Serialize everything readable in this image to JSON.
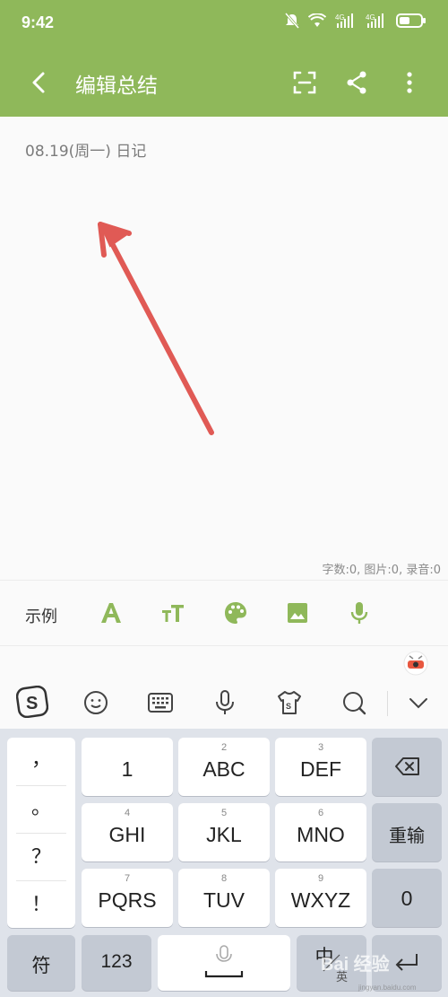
{
  "status_bar": {
    "time": "9:42"
  },
  "app_bar": {
    "title": "编辑总结"
  },
  "editor": {
    "date_line": "08.19(周一) 日记",
    "counts": "字数:0, 图片:0, 录音:0"
  },
  "toolbar": {
    "example_label": "示例"
  },
  "keyboard": {
    "symbols": [
      "，",
      "。",
      "？",
      "！"
    ],
    "keys": [
      {
        "sub": "",
        "main": "1"
      },
      {
        "sub": "2",
        "main": "ABC"
      },
      {
        "sub": "3",
        "main": "DEF"
      },
      {
        "sub": "4",
        "main": "GHI"
      },
      {
        "sub": "5",
        "main": "JKL"
      },
      {
        "sub": "6",
        "main": "MNO"
      },
      {
        "sub": "7",
        "main": "PQRS"
      },
      {
        "sub": "8",
        "main": "TUV"
      },
      {
        "sub": "9",
        "main": "WXYZ"
      }
    ],
    "retype": "重输",
    "zero": "0",
    "fu": "符",
    "num123": "123",
    "zh_key": "中",
    "en_sub": "英"
  },
  "watermark": {
    "main": "Bai 经验",
    "sub": "jingyan.baidu.com"
  },
  "colors": {
    "accent": "#8fb85a",
    "annotation": "#e05a55"
  }
}
